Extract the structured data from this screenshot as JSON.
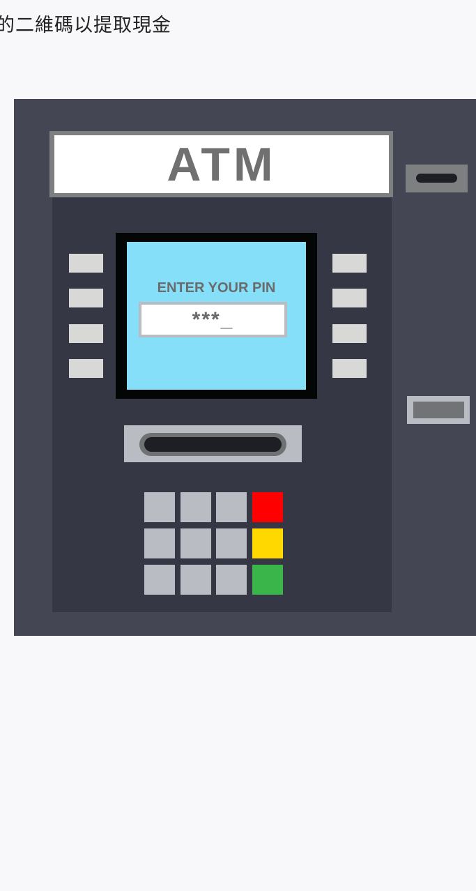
{
  "instruction": "的二維碼以提取現金",
  "atm": {
    "sign_text": "ATM",
    "screen": {
      "prompt": "ENTER YOUR PIN",
      "pin_display": "***_",
      "background_color": "#86dff9"
    },
    "keypad": {
      "cancel_color": "#ff0000",
      "clear_color": "#ffd800",
      "enter_color": "#3ab54a"
    }
  }
}
